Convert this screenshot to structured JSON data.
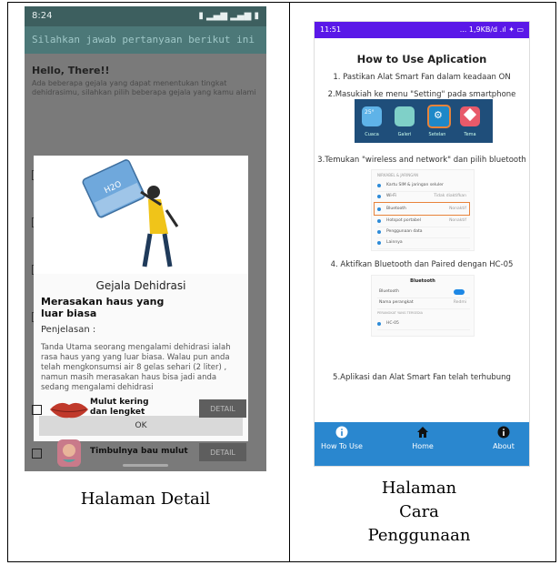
{
  "left": {
    "status_time": "8:24",
    "status_right": "▮ ▂▄▆ ▂▄▆ ▮",
    "app_title": "Silahkan jawab pertanyaan berikut ini",
    "hello": "Hello, There!!",
    "intro": "Ada beberapa gejala yang dapat menentukan tingkat dehidrasimu, silahkan pilih beberapa gejala yang kamu alami",
    "dialog": {
      "title": "Gejala Dehidrasi",
      "subtitle_l1": "Merasakan haus yang",
      "subtitle_l2": "luar biasa",
      "penjelasan": "Penjelasan :",
      "desc": "Tanda Utama seorang mengalami dehidrasi ialah rasa haus yang yang luar biasa. Walau pun anda telah mengkonsumsi air 8 gelas sehari (2 liter) , namun masih merasakan haus bisa jadi anda sedang  mengalami dehidrasi",
      "ok": "OK",
      "bottle_label": "H2O"
    },
    "rows": [
      {
        "label_l1": "Mulut kering",
        "label_l2": "dan lengket",
        "detail": "DETAIL"
      },
      {
        "label_l1": "Timbulnya bau mulut",
        "label_l2": "",
        "detail": "DETAIL"
      }
    ],
    "caption": "Halaman Detail"
  },
  "right": {
    "status_time": "11:51",
    "status_right": "... 1,9KB/d .ıl ✦ ▭",
    "title": "How to Use Aplication",
    "steps": [
      "1. Pastikan Alat Smart Fan dalam keadaan ON",
      "2.Masukiah ke menu  \"Setting\" pada smartphone",
      "3.Temukan \"wireless and network\" dan pilih bluetooth",
      "4. Aktifkan Bluetooth dan Paired dengan HC-05",
      "5.Aplikasi dan Alat Smart Fan telah terhubung"
    ],
    "apps": [
      "Cuaca",
      "Galeri",
      "Setelan",
      "Tema"
    ],
    "weather_temp": "25°",
    "settings_rows": [
      {
        "label": "Kartu SIM & jaringan seluler",
        "value": ""
      },
      {
        "label": "Wi-Fi",
        "value": "Tidak diaktifkan"
      },
      {
        "label": "Bluetooth",
        "value": "Nonaktif"
      },
      {
        "label": "Hotspot portabel",
        "value": "Nonaktif"
      },
      {
        "label": "Penggunaan data",
        "value": ""
      },
      {
        "label": "Lainnya",
        "value": ""
      }
    ],
    "settings_header": "NIRKABEL & JARINGAN",
    "bt_title": "Bluetooth",
    "bt_rows": [
      {
        "label": "Bluetooth",
        "value": ""
      },
      {
        "label": "Nama perangkat",
        "value": "Redmi"
      },
      {
        "label": "HC-05",
        "value": ""
      }
    ],
    "bt_header": "PERANGKAT YANG TERSEDIA",
    "nav": [
      {
        "label": "How To Use",
        "icon": "info-icon"
      },
      {
        "label": "Home",
        "icon": "home-icon"
      },
      {
        "label": "About",
        "icon": "info-icon"
      }
    ],
    "caption_l1": "Halaman",
    "caption_l2": "Cara",
    "caption_l3": "Penggunaan"
  }
}
